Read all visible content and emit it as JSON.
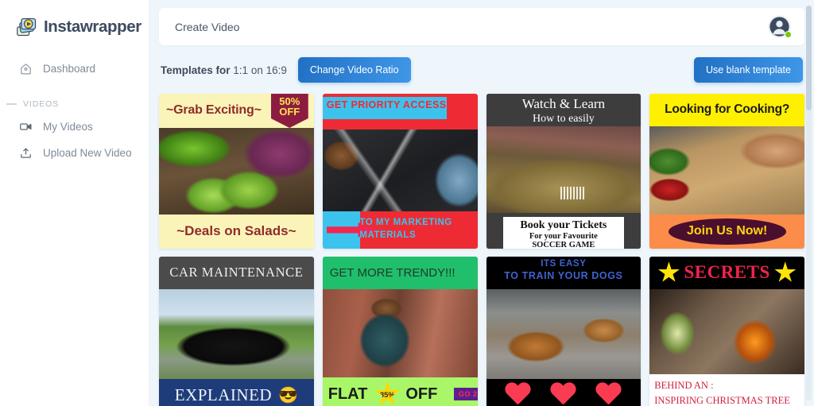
{
  "brand": {
    "name": "Instawrapper",
    "logo_icon": "stacked-photos-play-logo"
  },
  "sidebar": {
    "items": [
      {
        "label": "Dashboard",
        "icon": "home-icon"
      }
    ],
    "section": {
      "label": "VIDEOS"
    },
    "video_items": [
      {
        "label": "My Videos",
        "icon": "video-camera-icon"
      },
      {
        "label": "Upload New Video",
        "icon": "upload-icon"
      }
    ]
  },
  "topbar": {
    "title": "Create Video",
    "avatar_icon": "user-avatar-icon",
    "status": "online"
  },
  "subbar": {
    "templates_label": "Templates for",
    "ratio_value": "1:1 on 16:9",
    "change_ratio_label": "Change Video Ratio",
    "blank_template_label": "Use blank template"
  },
  "colors": {
    "accent_blue": "#2f86d8",
    "page_bg": "#eff6fb",
    "sidebar_text": "#7e8a99",
    "status_green": "#7ac70c"
  },
  "templates": [
    {
      "id": "salad",
      "header_text": "~Grab Exciting~",
      "footer_text": "~Deals on Salads~",
      "ribbon_line1": "50%",
      "ribbon_line2": "OFF",
      "photo": "cucumber-salad-photo"
    },
    {
      "id": "marketing",
      "header_text": "GET PRIORITY ACCESS",
      "footer_text": "TO MY MARKETING MATERIALS",
      "photo": "marketing-brochure-photo"
    },
    {
      "id": "soccer",
      "header_line1": "Watch & Learn",
      "header_line2": "How to easily",
      "footer_line1": "Book your Tickets",
      "footer_line2": "For your Favourite",
      "footer_line3": "SOCCER GAME",
      "photo": "soccer-stadium-photo"
    },
    {
      "id": "cooking",
      "header_text": "Looking for Cooking?",
      "footer_text": "Join Us Now!",
      "photo": "cutting-board-cooking-photo"
    },
    {
      "id": "car",
      "header_text": "CAR MAINTENANCE",
      "footer_text": "EXPLAINED",
      "footer_emoji": "😎",
      "photo": "black-convertible-car-photo"
    },
    {
      "id": "trendy",
      "header_text": "GET MORE TRENDY!!!",
      "footer_word1": "FLAT",
      "footer_star": "35%",
      "footer_word2": "OFF",
      "footer_badge": "GO  2",
      "photo": "fashion-woman-brick-wall-photo"
    },
    {
      "id": "dogs",
      "header_line1": "ITS EASY",
      "header_line2": "TO TRAIN YOUR DOGS",
      "footer_icons": [
        "heart-icon",
        "heart-icon",
        "heart-icon"
      ],
      "photo": "puppy-mirror-photo"
    },
    {
      "id": "christmas",
      "header_text": "SECRETS",
      "footer_line1": "BEHIND AN :",
      "footer_line2": "INSPIRING CHRISTMAS TREE",
      "photo": "christmas-tree-fireplace-photo"
    }
  ]
}
